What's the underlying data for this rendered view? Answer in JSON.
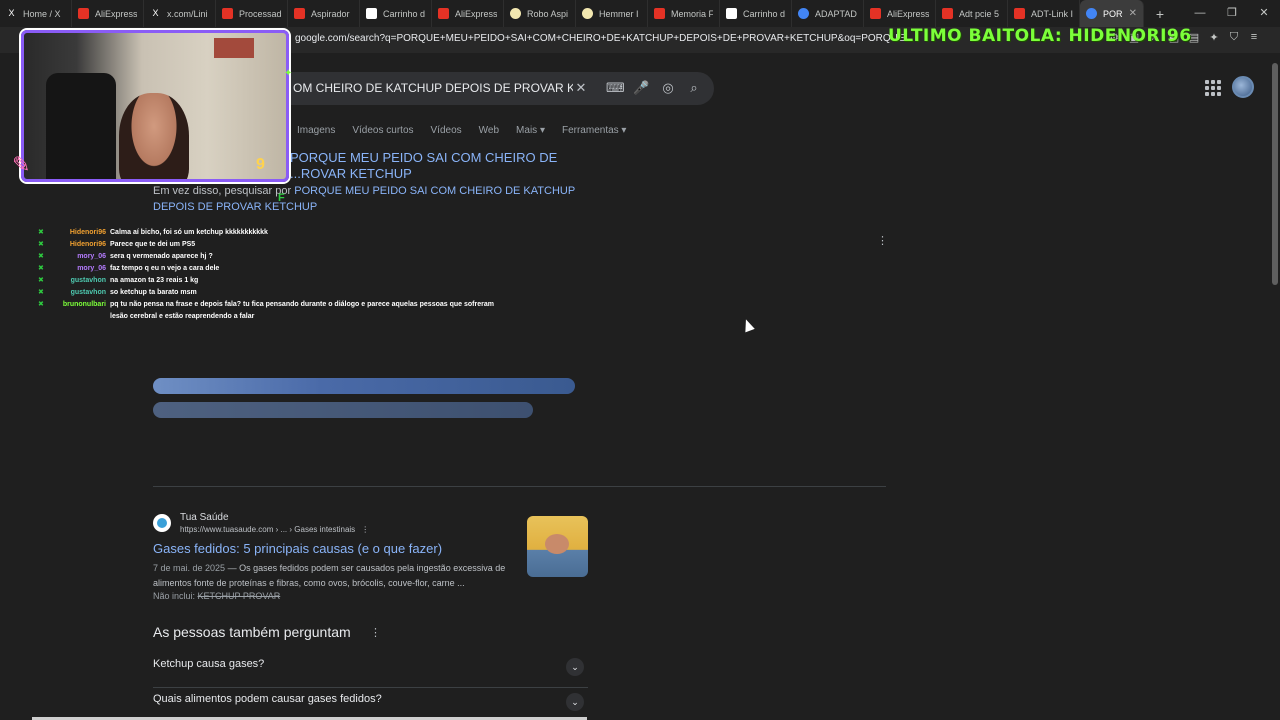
{
  "tabs": [
    {
      "title": "Home / X",
      "color": "#000000"
    },
    {
      "title": "AliExpress",
      "color": "#e43225"
    },
    {
      "title": "x.com/Lini",
      "color": "#000000"
    },
    {
      "title": "Processad",
      "color": "#e43225"
    },
    {
      "title": "Aspirador",
      "color": "#e43225"
    },
    {
      "title": "Carrinho d",
      "color": "#ffffff"
    },
    {
      "title": "AliExpress",
      "color": "#e43225"
    },
    {
      "title": "Robo Aspi",
      "color": "#f2e7b0"
    },
    {
      "title": "Hemmer I",
      "color": "#f2e7b0"
    },
    {
      "title": "Memoria F",
      "color": "#e43225"
    },
    {
      "title": "Carrinho d",
      "color": "#ffffff"
    },
    {
      "title": "ADAPTADO",
      "color": "#4285f4"
    },
    {
      "title": "AliExpress",
      "color": "#e43225"
    },
    {
      "title": "Adt pcie 5",
      "color": "#e43225"
    },
    {
      "title": "ADT-Link I",
      "color": "#e43225"
    }
  ],
  "active_tab": {
    "title": "PORQ",
    "close": "✕"
  },
  "new_tab_label": "+",
  "window": {
    "minimize": "—",
    "restore": "❐",
    "close": "✕"
  },
  "address_bar": {
    "url": "google.com/search?q=PORQUE+MEU+PEIDO+SAI+COM+CHEIRO+DE+KATCHUP+DEPOIS+DE+PROVAR+KETCHUP&oq=PORQUE+MEU+PEIDO+SAI+COM"
  },
  "stream_banner": "ULTIMO BAITOLA: HIDENORI96",
  "search": {
    "query": "OM CHEIRO DE KATCHUP DEPOIS DE PROVAR KETC",
    "clear_icon": "✕",
    "keyboard_icon": "⌨",
    "mic_icon": "🎤",
    "lens_icon": "◎",
    "search_icon": "⌕"
  },
  "filters": [
    "Imagens",
    "Vídeos curtos",
    "Vídeos",
    "Web",
    "Mais ▾",
    "Ferramentas ▾"
  ],
  "spelling": {
    "main": "PORQUE MEU PEIDO SAI COM CHEIRO DE ...ROVAR KETCHUP",
    "alt_prefix": "Em vez disso, pesquisar por ",
    "alt_link": "PORQUE MEU PEIDO SAI COM CHEIRO DE KATCHUP DEPOIS DE PROVAR KETCHUP"
  },
  "chat": [
    {
      "user": "Hidenori96",
      "color": "#f0a030",
      "msg": "Calma aí bicho, foi só um ketchup kkkkkkkkkkk"
    },
    {
      "user": "Hidenori96",
      "color": "#f0a030",
      "msg": "Parece que te dei um PS5"
    },
    {
      "user": "mory_06",
      "color": "#b57cff",
      "msg": "sera q vermenado aparece hj ?"
    },
    {
      "user": "mory_06",
      "color": "#b57cff",
      "msg": "faz tempo q eu n vejo a cara dele"
    },
    {
      "user": "gustavhon",
      "color": "#4ec9b0",
      "msg": "na amazon ta 23 reais 1 kg"
    },
    {
      "user": "gustavhon",
      "color": "#4ec9b0",
      "msg": "so ketchup ta barato msm"
    },
    {
      "user": "brunonulbari",
      "color": "#7CFF3A",
      "msg": "pq tu não pensa na frase e depois fala? tu fica pensando durante o diálogo e parece aquelas pessoas que sofreram lesão cerebral e estão reaprendendo a falar"
    }
  ],
  "result": {
    "site": "Tua Saúde",
    "url": "https://www.tuasaude.com › ... › Gases intestinais",
    "title": "Gases fedidos: 5 principais causas (e o que fazer)",
    "date": "7 de mai. de 2025",
    "snippet": " — Os gases fedidos podem ser causados pela ingestão excessiva de alimentos fonte de proteínas e fibras, como ovos, brócolis, couve-flor, carne ...",
    "missing_label": "Não inclui: ",
    "missing_terms": "KETCHUP PROVAR"
  },
  "paa": {
    "title": "As pessoas também perguntam",
    "questions": [
      "Ketchup causa gases?",
      "Quais alimentos podem causar gases fedidos?"
    ]
  }
}
